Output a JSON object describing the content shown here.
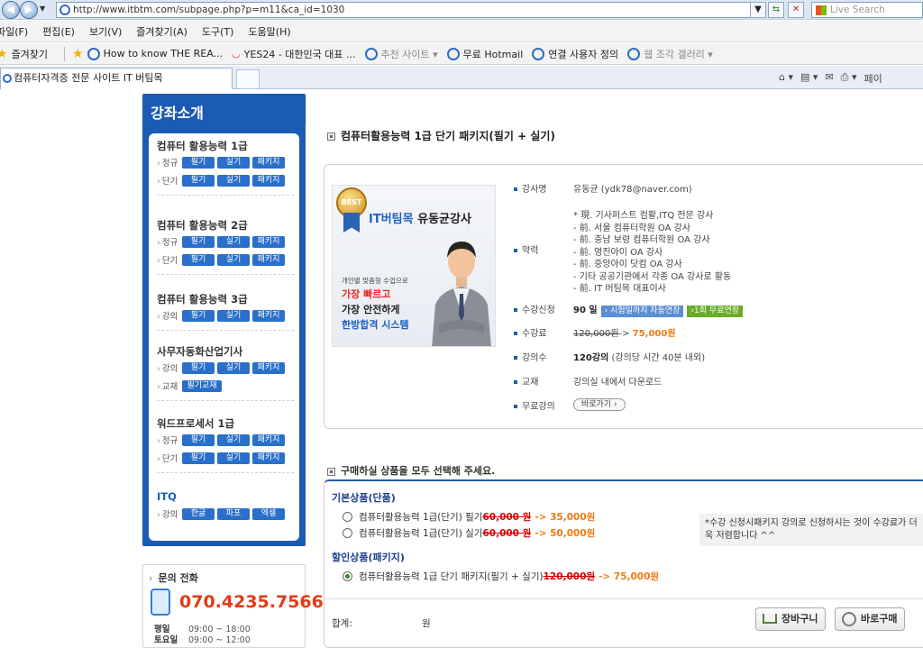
{
  "browser": {
    "url": "http://www.itbtm.com/subpage.php?p=m11&ca_id=1030",
    "search_placeholder": "Live Search",
    "menu": [
      "파일(F)",
      "편집(E)",
      "보기(V)",
      "즐겨찾기(A)",
      "도구(T)",
      "도움말(H)"
    ],
    "favorites_label": "즐겨찾기",
    "favorites": [
      "How to know THE REA...",
      "YES24 - 대한민국 대표 ...",
      "추천 사이트 ▾",
      "무료 Hotmail",
      "연결 사용자 정의",
      "웹 조각 갤러리 ▾"
    ],
    "tab_title": "컴퓨터자격증 전문 사이트 IT 버팀목",
    "right_tools": [
      "⌂ ▾",
      "▤ ▾",
      "✉",
      "⎙ ▾",
      "페이"
    ]
  },
  "sidebar": {
    "title": "강좌소개",
    "groups": [
      {
        "title": "컴퓨터 활용능력 1급",
        "rows": [
          {
            "label": "정규",
            "buttons": [
              "필기",
              "실기",
              "패키지"
            ]
          },
          {
            "label": "단기",
            "buttons": [
              "필기",
              "실기",
              "패키지"
            ]
          }
        ]
      },
      {
        "title": "컴퓨터 활용능력 2급",
        "rows": [
          {
            "label": "정규",
            "buttons": [
              "필기",
              "실기",
              "패키지"
            ]
          },
          {
            "label": "단기",
            "buttons": [
              "필기",
              "실기",
              "패키지"
            ]
          }
        ]
      },
      {
        "title": "컴퓨터 활용능력 3급",
        "rows": [
          {
            "label": "강의",
            "buttons": [
              "필기",
              "실기",
              "패키지"
            ]
          }
        ]
      },
      {
        "title": "사무자동화산업기사",
        "rows": [
          {
            "label": "강의",
            "buttons": [
              "필기",
              "실기",
              "패키지"
            ]
          },
          {
            "label": "교재",
            "buttons": [
              "필기교재"
            ]
          }
        ]
      },
      {
        "title": "워드프로세서 1급",
        "rows": [
          {
            "label": "정규",
            "buttons": [
              "필기",
              "실기",
              "패키지"
            ]
          },
          {
            "label": "단기",
            "buttons": [
              "필기",
              "실기",
              "패키지"
            ]
          }
        ]
      },
      {
        "title": "ITQ",
        "rows": [
          {
            "label": "강의",
            "buttons": [
              "한글",
              "파포",
              "엑셀"
            ]
          }
        ]
      }
    ]
  },
  "contact": {
    "title": "문의 전화",
    "phone": "070.4235.7566",
    "weekday_label": "평일",
    "weekday_hours": "09:00 ~ 18:00",
    "saturday_label": "토요일",
    "saturday_hours": "09:00 ~ 12:00"
  },
  "product": {
    "title": "컴퓨터활용능력 1급 단기 패키지(필기 + 실기)",
    "promo": {
      "badge": "BEST",
      "brand": "IT버팀목",
      "teacher": "유동균강사",
      "tagline": "개인별 맞춤형 수업으로",
      "line1": "가장 빠르고",
      "line2": "가장 안전하게",
      "line3": "한방합격 시스템"
    },
    "labels": {
      "instructor": "강사명",
      "career": "약력",
      "duration": "수강신청",
      "fee": "수강료",
      "lectures": "강의수",
      "material": "교재",
      "free": "무료강의"
    },
    "instructor": "유동균 (ydk78@naver.com)",
    "career": [
      "* 現. 기사퍼스트 컴활,ITQ 전문 강사",
      "- 前. 서울 컴퓨터학원 OA 강사",
      "- 前. 충남 보령 컴퓨터학원 OA 강사",
      "- 前. 영진아이 OA 강사",
      "- 前. 중앙아이 닷컴 OA 강사",
      "- 기타 공공기관에서 각종 OA 강사로 활동",
      "- 前. IT 버팀목 대표이사"
    ],
    "duration": "90 일",
    "duration_tag1": "› 시험일까지 자동연장",
    "duration_tag2": "›1회 무료연장",
    "fee_original": "120,000원",
    "fee_arrow": "->",
    "fee_sale": "75,000원",
    "lectures_count": "120강의",
    "lectures_note": "(강의당 시간 40분 내외)",
    "material": "강의실 내에서 다운로드",
    "free_button": "바로가기 ›"
  },
  "order": {
    "section_title": "구매하실 상품을 모두 선택해 주세요.",
    "basic_title": "기본상품(단품)",
    "basic_items": [
      {
        "name": "컴퓨터활용능력 1급(단기) 필기",
        "original": "60,000 원",
        "sale": "-> 35,000원"
      },
      {
        "name": "컴퓨터활용능력 1급(단기) 실기",
        "original": "60,000 원",
        "sale": "-> 50,000원"
      }
    ],
    "note": "*수강 신청시패키지 강의로 신청하시는 것이 수강료가 더욱 저렴합니다 ^^",
    "discount_title": "할인상품(패키지)",
    "discount_item": {
      "name": "컴퓨터활용능력 1급 단기 패키지(필기 + 실기)",
      "original": "120,000원",
      "sale": "-> 75,000원"
    },
    "total_label": "합계:",
    "total_unit": "원",
    "cart_button": "장바구니",
    "buy_button": "바로구매"
  }
}
